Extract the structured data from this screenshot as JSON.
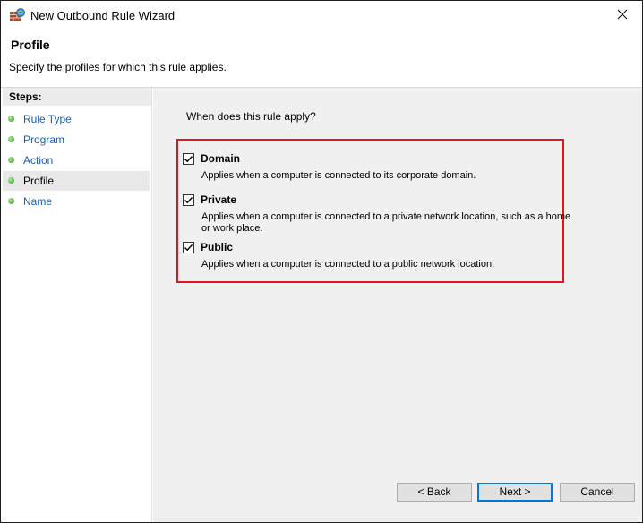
{
  "window": {
    "title": "New Outbound Rule Wizard",
    "app_icon": "firewall-icon",
    "close_icon": "close-icon"
  },
  "header": {
    "title": "Profile",
    "description": "Specify the profiles for which this rule applies."
  },
  "steps": {
    "title": "Steps:",
    "items": [
      {
        "label": "Rule Type"
      },
      {
        "label": "Program"
      },
      {
        "label": "Action"
      },
      {
        "label": "Profile",
        "current": true
      },
      {
        "label": "Name"
      }
    ]
  },
  "main": {
    "question": "When does this rule apply?",
    "highlight_color": "#e3161f",
    "profiles": [
      {
        "name": "Domain",
        "checked": true,
        "description": "Applies when a computer is connected to its corporate domain."
      },
      {
        "name": "Private",
        "checked": true,
        "description": "Applies when a computer is connected to a private network location, such as a home or work place."
      },
      {
        "name": "Public",
        "checked": true,
        "description": "Applies when a computer is connected to a public network location."
      }
    ]
  },
  "buttons": {
    "back": "< Back",
    "next": "Next >",
    "cancel": "Cancel"
  }
}
